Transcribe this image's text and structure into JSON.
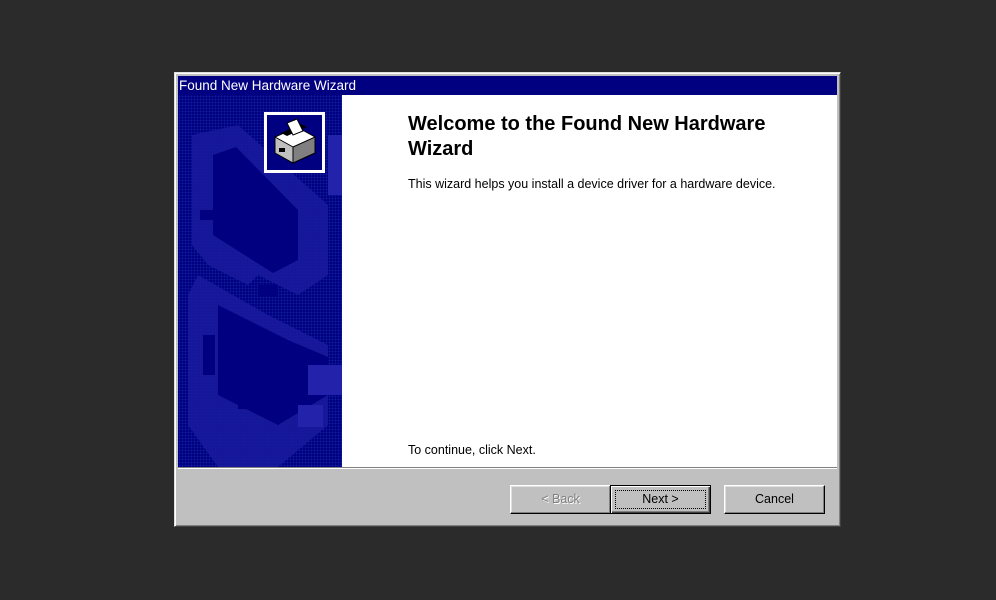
{
  "window": {
    "title": "Found New Hardware Wizard"
  },
  "sidebar": {
    "icon": "hardware-card-icon",
    "colors": {
      "background": "#000080",
      "pattern": "#1a1a99"
    }
  },
  "content": {
    "heading": "Welcome to the Found New Hardware Wizard",
    "description": "This wizard helps you install a device driver for a hardware device.",
    "continue_text": "To continue, click Next."
  },
  "buttons": {
    "back": {
      "label": "< Back",
      "enabled": false
    },
    "next": {
      "label": "Next >",
      "enabled": true,
      "default": true
    },
    "cancel": {
      "label": "Cancel",
      "enabled": true
    }
  },
  "colors": {
    "titlebar": "#000080",
    "face": "#c0c0c0",
    "content_bg": "#ffffff"
  }
}
